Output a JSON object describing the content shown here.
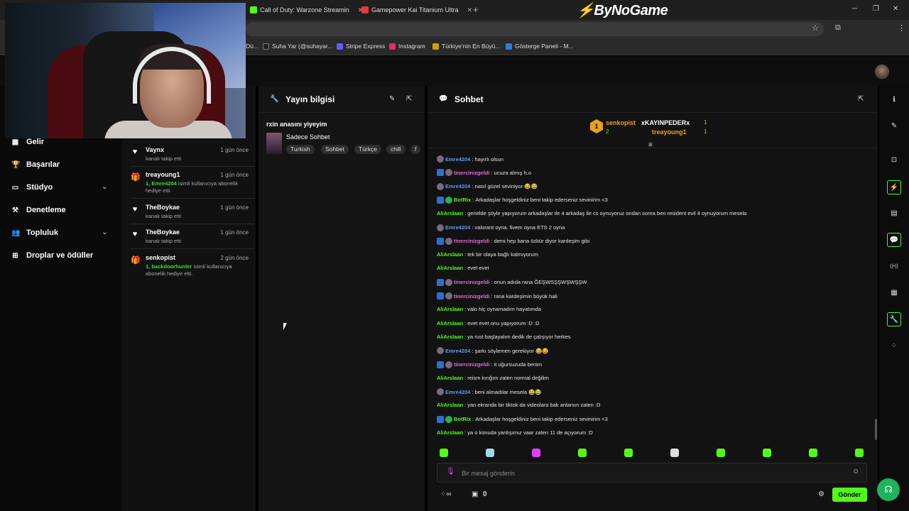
{
  "browser": {
    "tabs": [
      {
        "label": "Call of Duty: Warzone Streamin",
        "color": "#53fc18"
      },
      {
        "label": "Gamepower Kai Titanium Ultra",
        "color": "#e53935"
      }
    ],
    "new_tab_icon": "plus-icon",
    "brand_mark": "⚡",
    "brand": "ByNoGame",
    "window_controls": {
      "minimize": "─",
      "restore": "❐",
      "close": "✕"
    },
    "toolbar_icons": {
      "star": "☆",
      "extensions": "⧉",
      "menu": "⋮"
    },
    "bookmarks": [
      {
        "label": "Dü...",
        "color": "#555"
      },
      {
        "label": "Suha Yar (@suhayar...",
        "color": "#222"
      },
      {
        "label": "Stripe Express",
        "color": "#635bff"
      },
      {
        "label": "Instagram",
        "color": "#e1306c"
      },
      {
        "label": "Türkiye'nin En Büyü...",
        "color": "#d4a000"
      },
      {
        "label": "Gösterge Paneli - M...",
        "color": "#2c7be5"
      }
    ]
  },
  "sidebar": {
    "items": [
      {
        "label": "Gelir",
        "icon": "▦"
      },
      {
        "label": "Başarılar",
        "icon": "🏆"
      },
      {
        "label": "Stüdyo",
        "icon": "▭",
        "chevron": "⌄"
      },
      {
        "label": "Denetleme",
        "icon": "⚒"
      },
      {
        "label": "Topluluk",
        "icon": "👥",
        "chevron": "⌄"
      },
      {
        "label": "Droplar ve ödüller",
        "icon": "⊞"
      }
    ]
  },
  "activity": {
    "items": [
      {
        "icon": "♥",
        "name": "Vaynx",
        "time": "1 gün önce",
        "sub_strong": "",
        "sub": "kanalı takip etti"
      },
      {
        "icon": "🎁",
        "name": "treayoung1",
        "time": "1 gün önce",
        "sub_strong": "1, Emre4204",
        "sub": " isimli kullanıcıya abonelik hediye etti."
      },
      {
        "icon": "♥",
        "name": "TheBoykae",
        "time": "1 gün önce",
        "sub_strong": "",
        "sub": "kanalı takip etti"
      },
      {
        "icon": "♥",
        "name": "TheBoykae",
        "time": "1 gün önce",
        "sub_strong": "",
        "sub": "kanalı takip etti"
      },
      {
        "icon": "🎁",
        "name": "senkopist",
        "time": "2 gün önce",
        "sub_strong": "1, backdoorhunter",
        "sub": " isimli kullanıcıya abonelik hediye etti."
      }
    ]
  },
  "stream_info": {
    "title": "Yayın bilgisi",
    "stream_title": "rxin anasını yiyeyim",
    "category": "Sadece Sohbet",
    "tags": [
      "Turkish",
      "Sohbet",
      "Türkçe",
      "chill",
      "f"
    ],
    "edit_icon": "✎",
    "popout_icon": "⇱"
  },
  "chat": {
    "title": "Sohbet",
    "leaderboard": {
      "first": {
        "rank": "1",
        "name": "senkopist",
        "count": "2"
      },
      "others": [
        {
          "name": "xKAYINPEDERx",
          "count": "1"
        },
        {
          "name": "treayoung1",
          "count": "1"
        }
      ]
    },
    "messages": [
      {
        "user": "Emre4204",
        "color": "#5b9bf0",
        "badges": [
          "shield"
        ],
        "text": "hayırlı olsun"
      },
      {
        "user": "tinercinizgeldi",
        "color": "#e36ad8",
        "badges": [
          "mod",
          "shield"
        ],
        "text": "ucuza almış h.o"
      },
      {
        "user": "Emre4204",
        "color": "#5b9bf0",
        "badges": [
          "shield"
        ],
        "text": "nasıl güzel seviniyor 😂😂"
      },
      {
        "user": "BotRix",
        "color": "#53fc18",
        "badges": [
          "mod",
          "bot"
        ],
        "text": "Arkadaşlar hoşgeldiniz beni takip ederseniz sevinirim <3"
      },
      {
        "user": "AliArslaan",
        "color": "#53fc18",
        "badges": [],
        "text": "genelde şöyle yapıyorum arkadaşlar ile 4 arkadaş ile cs oynuyoruz ondan sonra ben resident evil 4 oynuyorum mesela"
      },
      {
        "user": "Emre4204",
        "color": "#5b9bf0",
        "badges": [
          "shield"
        ],
        "text": "valorant oyna. fivem oyna ETS 2 oyna"
      },
      {
        "user": "tinercinizgeldi",
        "color": "#e36ad8",
        "badges": [
          "mod",
          "shield"
        ],
        "text": "demi hep bana özkür diyor kardeşim gibi"
      },
      {
        "user": "AliArslaan",
        "color": "#53fc18",
        "badges": [],
        "text": "tek bir olaya bağlı kalmıyorum"
      },
      {
        "user": "AliArslaan",
        "color": "#53fc18",
        "badges": [],
        "text": "evet evet"
      },
      {
        "user": "tinercinizgeldi",
        "color": "#e36ad8",
        "badges": [
          "mod",
          "shield"
        ],
        "text": "onun adıda rana ĞEŞWSŞŞWŞWŞŞW"
      },
      {
        "user": "tinercinizgeldi",
        "color": "#e36ad8",
        "badges": [
          "mod",
          "shield"
        ],
        "text": "rana kardeşimin büyük hali"
      },
      {
        "user": "AliArslaan",
        "color": "#53fc18",
        "badges": [],
        "text": "valo hiç oynamadım hayatımda"
      },
      {
        "user": "AliArslaan",
        "color": "#53fc18",
        "badges": [],
        "text": "evet evet onu yapıyorum :D :D"
      },
      {
        "user": "AliArslaan",
        "color": "#53fc18",
        "badges": [],
        "text": "ya rust başlayalım dedik de çalışıyor herkes"
      },
      {
        "user": "Emre4204",
        "color": "#5b9bf0",
        "badges": [
          "shield"
        ],
        "text": "şarkı söylemen gerekiyor 😂😂"
      },
      {
        "user": "tinercinizgeldi",
        "color": "#e36ad8",
        "badges": [
          "mod",
          "shield"
        ],
        "text": "it uğursuzuda benim"
      },
      {
        "user": "AliArslaan",
        "color": "#53fc18",
        "badges": [],
        "text": "reism kırığım zaten normal değilim"
      },
      {
        "user": "Emre4204",
        "color": "#5b9bf0",
        "badges": [
          "shield"
        ],
        "text": "beni almadılar mesela 😂😂"
      },
      {
        "user": "AliArslaan",
        "color": "#53fc18",
        "badges": [],
        "text": "yan ekranda bir tiktok da videolara bak anlarsın zaten :D"
      },
      {
        "user": "BotRix",
        "color": "#53fc18",
        "badges": [
          "mod",
          "bot"
        ],
        "text": "Arkadaşlar hoşgeldiniz beni takip ederseniz sevinirim <3"
      },
      {
        "user": "AliArslaan",
        "color": "#53fc18",
        "badges": [],
        "text": "ya o konuda yanlışımız vaar zaten 11 de açıyorum :D"
      }
    ],
    "emote_colors": [
      "#53fc18",
      "#9fd8e8",
      "#e040fb",
      "#53fc18",
      "#53fc18",
      "#ddd",
      "#53fc18",
      "#53fc18",
      "#53fc18",
      "#53fc18"
    ],
    "input_placeholder": "Bir mesaj gönderin",
    "viewer_count": "0",
    "send_label": "Gönder"
  },
  "rightbar_icons": [
    {
      "name": "info-icon",
      "glyph": "ℹ",
      "active": false
    },
    {
      "name": "pencil-icon",
      "glyph": "✎",
      "active": false
    },
    {
      "name": "crop-icon",
      "glyph": "⊡",
      "active": false
    },
    {
      "name": "bolt-icon",
      "glyph": "⚡",
      "active": true
    },
    {
      "name": "document-icon",
      "glyph": "▤",
      "active": false
    },
    {
      "name": "chat-icon",
      "glyph": "💬",
      "active": true
    },
    {
      "name": "broadcast-icon",
      "glyph": "((•))",
      "active": false
    },
    {
      "name": "server-icon",
      "glyph": "▦",
      "active": false
    },
    {
      "name": "wrench-icon",
      "glyph": "🔧",
      "active": true
    },
    {
      "name": "dots-icon",
      "glyph": "⁘",
      "active": false
    }
  ],
  "colors": {
    "accent": "#53fc18",
    "mod": "#2c6fd0",
    "bot": "#1fb35a"
  }
}
